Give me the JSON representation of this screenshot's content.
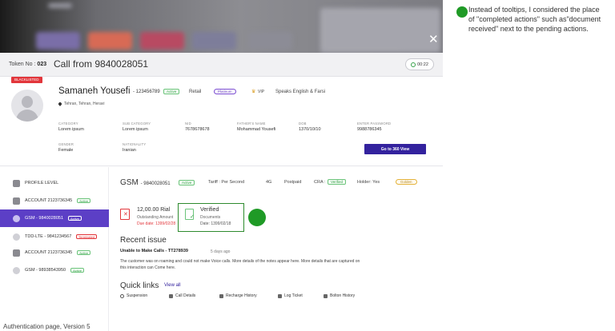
{
  "call": {
    "token_label": "Token No :",
    "token_value": "023",
    "title": "Call from 9840028051",
    "timer": "00:22"
  },
  "profile": {
    "status_tag": "BLACKLISTED",
    "name": "Samaneh Yousefi",
    "id": "- 123456789",
    "id_badge": "Active",
    "segment": "Retail",
    "tier": "Platinum",
    "vip": "VIP",
    "language": "Speaks English & Farsi",
    "location": "Tehran, Tehran, Heravi",
    "fields": [
      {
        "label": "CATEGORY",
        "value": "Lorem ipsum"
      },
      {
        "label": "SUB CATEGORY",
        "value": "Lorem ipsum"
      },
      {
        "label": "NID",
        "value": "7678678678"
      },
      {
        "label": "FATHER'S NAME",
        "value": "Mohammad Yousefi"
      },
      {
        "label": "DOB",
        "value": "1370/10/10"
      },
      {
        "label": "ENTER PASSWORD",
        "value": "9988786345"
      },
      {
        "label": "GENDER",
        "value": "Female"
      },
      {
        "label": "NATIONALITY",
        "value": "Iranian"
      }
    ],
    "view_button": "Go to 360 View"
  },
  "sidebar": {
    "items": [
      {
        "label": "PROFILE LEVEL",
        "badge": ""
      },
      {
        "label": "ACCOUNT 2123736345",
        "badge": "Active"
      },
      {
        "label": "GSM - 9840028051",
        "badge": "Active"
      },
      {
        "label": "TDD-LTE - 9841234567",
        "badge": "Terminated"
      },
      {
        "label": "ACCOUNT 2123736345",
        "badge": "Active"
      },
      {
        "label": "GSM - 98938543950",
        "badge": "Active"
      }
    ]
  },
  "gsm": {
    "title": "GSM",
    "number": "- 9840028051",
    "badge": "Active",
    "tariff": "Tariff : Per Second",
    "network": "4G",
    "type": "Postpaid",
    "cra_label": "CRA :",
    "cra_badge": "Verified",
    "holder": "Holder: Yes",
    "tier": "Golden"
  },
  "outstanding": {
    "amount": "12,00.00 Rial",
    "label": "Outstanding Amount",
    "due": "Due date: 1399/02/28"
  },
  "verified": {
    "title": "Verified",
    "sub": "Documents",
    "date": "Date: 1399/02/18"
  },
  "issue": {
    "heading": "Recent issue",
    "title": "Unable to Make Calls - TT278939",
    "age": "5 days ago",
    "body_line1": "The customer was on roaming and could not make  Voice calls. More details of the notes appear here. More details that are captured on",
    "body_line2": "this interaction can Come here."
  },
  "quicklinks": {
    "heading": "Quick links",
    "view_all": "View all",
    "items": [
      "Suspension",
      "Call Details",
      "Recharge History",
      "Log Ticket",
      "Bolton History"
    ]
  },
  "annotation": {
    "note": "Instead of tooltips, I considered the place of \"completed actions\" such as\"document received\" next to the pending actions."
  },
  "caption": "Authentication page, Version 5",
  "colors": {
    "accent": "#5c3fc6",
    "primary_button": "#33229e",
    "success": "#37a24a",
    "danger": "#e2363b",
    "annotation": "#1f9a26"
  }
}
